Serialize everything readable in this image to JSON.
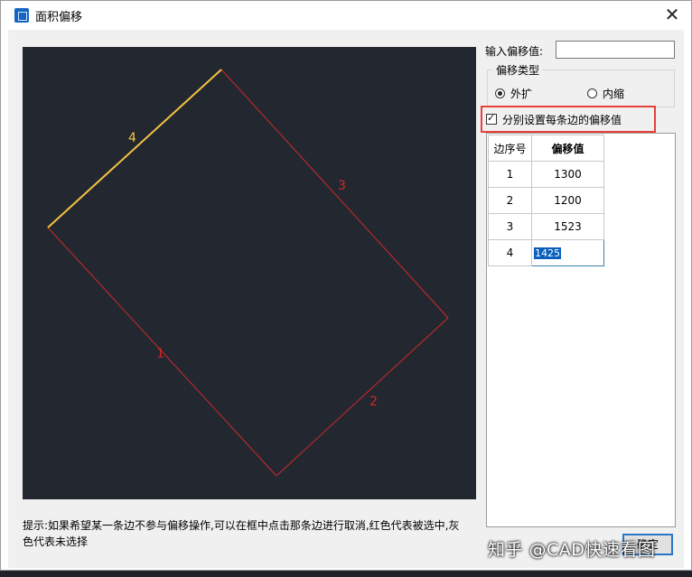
{
  "window": {
    "title": "面积偏移",
    "close_glyph": "✕",
    "icon": "app-icon"
  },
  "offset": {
    "label": "输入偏移值:",
    "value": ""
  },
  "offset_type": {
    "title": "偏移类型",
    "options": [
      {
        "label": "外扩",
        "selected": true
      },
      {
        "label": "内缩",
        "selected": false
      }
    ]
  },
  "per_edge": {
    "label": "分别设置每条边的偏移值",
    "checked": true
  },
  "table": {
    "headers": [
      "边序号",
      "偏移值"
    ],
    "rows": [
      {
        "edge": "1",
        "value": "1300"
      },
      {
        "edge": "2",
        "value": "1200"
      },
      {
        "edge": "3",
        "value": "1523"
      },
      {
        "edge": "4",
        "value": "1425"
      }
    ]
  },
  "preview": {
    "edge_labels": [
      "1",
      "2",
      "3",
      "4"
    ],
    "selected_color": "#e02020",
    "active_color": "#f5c342",
    "background": "#232830"
  },
  "hint": "提示:如果希望某一条边不参与偏移操作,可以在框中点击那条边进行取消,红色代表被选中,灰色代表未选择",
  "confirm_label": "确定",
  "watermark": "知乎 @CAD快速看图"
}
